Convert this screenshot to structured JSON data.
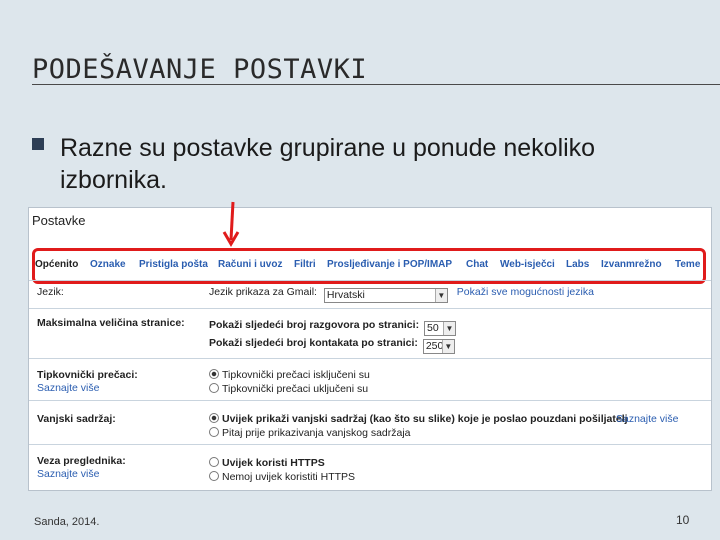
{
  "slide": {
    "title": "PODEŠAVANJE POSTAVKI",
    "bullet": "Razne su postavke grupirane u ponude nekoliko izbornika.",
    "footer_left": "Sanda, 2014.",
    "footer_right": "10"
  },
  "screenshot": {
    "title": "Postavke",
    "tabs": [
      {
        "label": "Općenito",
        "active": true
      },
      {
        "label": "Oznake"
      },
      {
        "label": "Pristigla pošta"
      },
      {
        "label": "Računi i uvoz"
      },
      {
        "label": "Filtri"
      },
      {
        "label": "Prosljeđivanje i POP/IMAP"
      },
      {
        "label": "Chat"
      },
      {
        "label": "Web-isječci"
      },
      {
        "label": "Labs"
      },
      {
        "label": "Izvanmrežno"
      },
      {
        "label": "Teme"
      }
    ],
    "language": {
      "label": "Jezik:",
      "field_label": "Jezik prikaza za Gmail:",
      "value": "Hrvatski",
      "link": "Pokaži sve mogućnosti jezika"
    },
    "page_size": {
      "label": "Maksimalna veličina stranice:",
      "conversations_label": "Pokaži sljedeći broj razgovora po stranici:",
      "conversations_value": "50",
      "contacts_label": "Pokaži sljedeći broj kontakata po stranici:",
      "contacts_value": "250"
    },
    "shortcuts": {
      "label": "Tipkovnički prečaci:",
      "learn_more": "Saznajte više",
      "on": "Tipkovnički prečaci isključeni su",
      "off": "Tipkovnički prečaci uključeni su"
    },
    "external": {
      "label": "Vanjski sadržaj:",
      "always": "Uvijek prikaži vanjski sadržaj (kao što su slike) koje je poslao pouzdani pošiljatelj",
      "learn_more": "Saznajte više",
      "ask": "Pitaj prije prikazivanja vanjskog sadržaja"
    },
    "browser": {
      "label": "Veza preglednika:",
      "learn_more": "Saznajte više",
      "always_https": "Uvijek koristi HTTPS",
      "no_https": "Nemoj uvijek koristiti HTTPS"
    }
  },
  "colors": {
    "highlight": "#e01b1b",
    "link": "#2a5db0",
    "bullet": "#2d3e55"
  }
}
